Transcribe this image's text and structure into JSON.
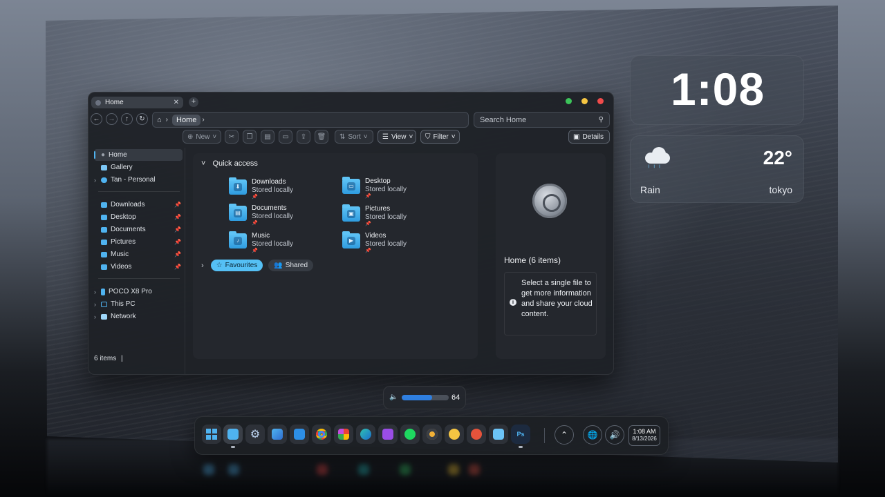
{
  "explorer": {
    "tab_title": "Home",
    "tab_close": "✕",
    "new_tab": "+",
    "nav": {
      "back": "←",
      "forward": "→",
      "up": "↑",
      "refresh": "↻"
    },
    "breadcrumb": "Home",
    "search_placeholder": "Search Home",
    "toolbar": {
      "new": "New",
      "sort": "Sort",
      "view": "View",
      "filter": "Filter",
      "details": "Details"
    },
    "sidebar": {
      "top": [
        {
          "label": "Home",
          "selected": true
        },
        {
          "label": "Gallery"
        },
        {
          "label": "Tan - Personal",
          "expandable": true
        }
      ],
      "pinned": [
        "Downloads",
        "Desktop",
        "Documents",
        "Pictures",
        "Music",
        "Videos"
      ],
      "devices": [
        "POCO X8 Pro",
        "This PC",
        "Network"
      ]
    },
    "status": "6 items",
    "quick_access": {
      "title": "Quick access",
      "items": [
        {
          "name": "Downloads",
          "status": "Stored locally",
          "glyph": "⬇"
        },
        {
          "name": "Desktop",
          "status": "Stored locally",
          "glyph": "▭"
        },
        {
          "name": "Documents",
          "status": "Stored locally",
          "glyph": "▤"
        },
        {
          "name": "Pictures",
          "status": "Stored locally",
          "glyph": "▣"
        },
        {
          "name": "Music",
          "status": "Stored locally",
          "glyph": "♪"
        },
        {
          "name": "Videos",
          "status": "Stored locally",
          "glyph": "▶"
        }
      ]
    },
    "favourites": "Favourites",
    "shared": "Shared",
    "details_pane": {
      "title": "Home (6 items)",
      "info": "Select a single file to get more information and share your cloud content."
    }
  },
  "clock_widget": {
    "time": "1:08"
  },
  "weather_widget": {
    "temperature": "22°",
    "condition": "Rain",
    "city": "tokyo"
  },
  "volume_osd": {
    "level": 64,
    "label": "64"
  },
  "taskbar": {
    "apps": [
      "start",
      "file-explorer",
      "settings",
      "photos",
      "store",
      "chrome",
      "apps-grid",
      "edge",
      "media-player",
      "spotify",
      "video-player",
      "weather",
      "maps",
      "notepad",
      "photoshop"
    ],
    "photoshop_label": "Ps",
    "clock_time": "1:08 AM",
    "clock_date": "8/13/2026"
  },
  "colors": {
    "accent": "#4fb3f0",
    "close": "#f04b4b",
    "minimize": "#f5c542",
    "maximize": "#3cc45a",
    "volume_fill": "#2f7fe0"
  }
}
